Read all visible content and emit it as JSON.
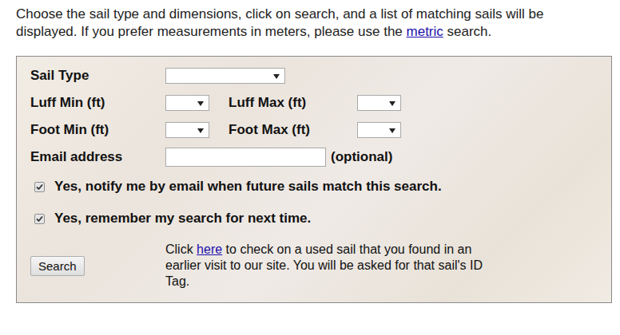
{
  "intro": {
    "before": "Choose the sail type and dimensions, click on search, and a list of matching sails will be displayed. If you prefer measurements in meters, please use the ",
    "link": "metric",
    "after": " search."
  },
  "form": {
    "sail_type": {
      "label": "Sail Type",
      "value": ""
    },
    "luff": {
      "min_label": "Luff Min (ft)",
      "min_value": "",
      "max_label": "Luff Max (ft)",
      "max_value": ""
    },
    "foot": {
      "min_label": "Foot Min (ft)",
      "min_value": "",
      "max_label": "Foot Max (ft)",
      "max_value": ""
    },
    "email": {
      "label": "Email address",
      "value": "",
      "note": "(optional)"
    },
    "options": [
      {
        "label": "Yes, notify me by email when future sails match this search.",
        "checked": true
      },
      {
        "label": "Yes, remember my search for next time.",
        "checked": true
      }
    ],
    "search_button": "Search",
    "recheck": {
      "before": "Click ",
      "link": "here",
      "after": " to check on a used sail that you found in an earlier visit to our site. You will be asked for that sail's ID Tag."
    }
  }
}
